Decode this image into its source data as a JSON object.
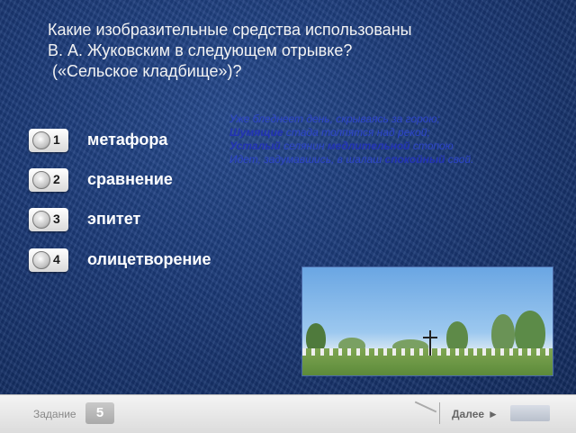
{
  "question": {
    "line1": "Какие изобразительные средства использованы",
    "line2": "В. А. Жуковским в следующем отрывке?",
    "line3": " («Сельское кладбище»)?"
  },
  "options": [
    {
      "number": "1",
      "label": "метафора"
    },
    {
      "number": "2",
      "label": "сравнение"
    },
    {
      "number": "3",
      "label": "эпитет"
    },
    {
      "number": "4",
      "label": "олицетворение"
    }
  ],
  "poem": {
    "l1": "Уже бледнеет день, скрываясь за горою;",
    "l2a": "Шумящие",
    "l2b": " стада толпятся над рекой;",
    "l3a": "Усталый",
    "l3b": " селянин ",
    "l3c": "медлительной",
    "l3d": " стопою",
    "l4a": "Идет, задумавшись, в шалаш ",
    "l4b": "спокойный",
    "l4c": " свой."
  },
  "footer": {
    "task_label": "Задание",
    "task_number": "5",
    "next_label": "Далее",
    "next_arrow": "►"
  },
  "colors": {
    "background": "#1b3a78",
    "poem_text": "#2c44c9",
    "question_text": "#f2f2f2"
  }
}
